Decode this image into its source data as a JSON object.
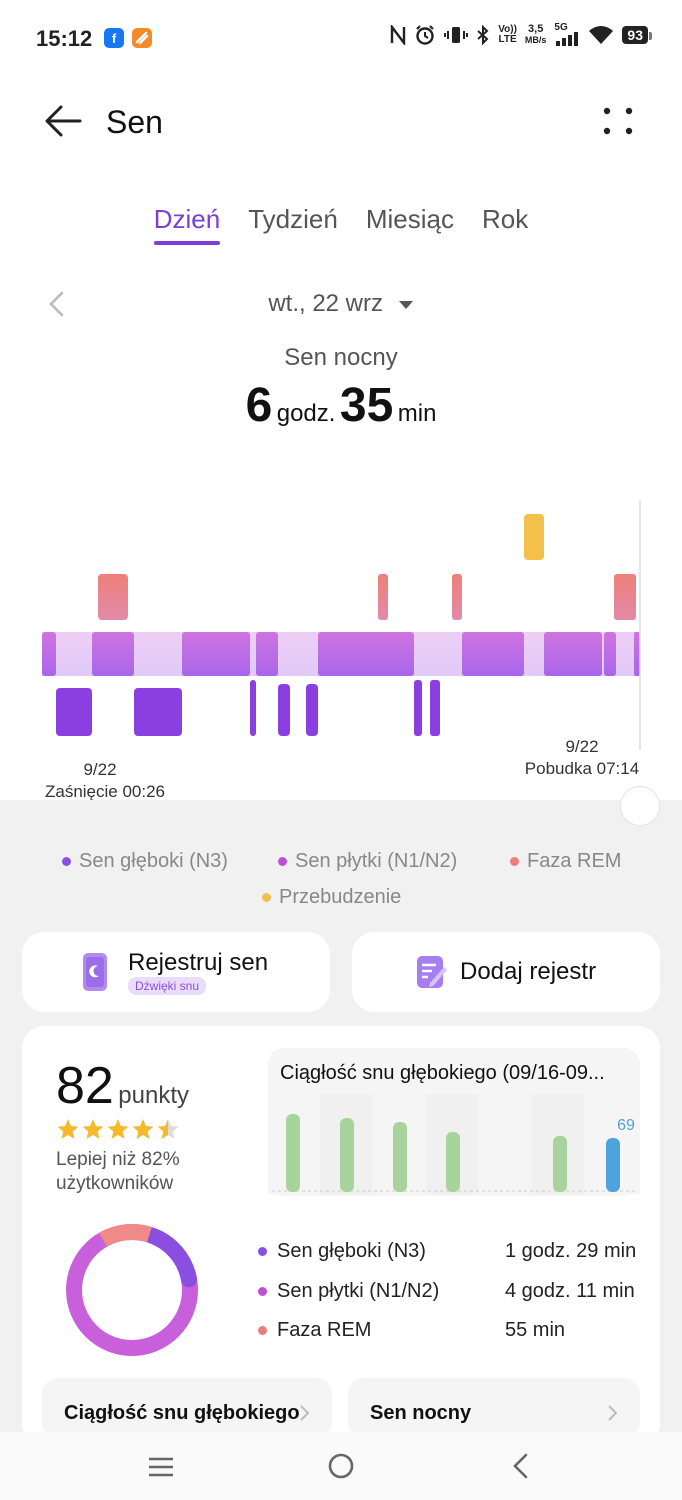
{
  "status_bar": {
    "time": "15:12",
    "icons": [
      "facebook-icon",
      "orange-app-icon",
      "nfc-icon",
      "alarm-icon",
      "vibrate-icon",
      "bluetooth-icon",
      "volte-icon",
      "data-speed",
      "signal-icon",
      "wifi-icon"
    ],
    "volte_top": "Vo))",
    "volte_bottom": "LTE",
    "speed_value": "3,5",
    "speed_unit": "MB/s",
    "network": "5G",
    "battery": "93"
  },
  "header": {
    "title": "Sen",
    "back_icon": "arrow-left-icon",
    "more_icon": "more-dots-icon"
  },
  "tabs": [
    {
      "label": "Dzień",
      "active": true
    },
    {
      "label": "Tydzień",
      "active": false
    },
    {
      "label": "Miesiąc",
      "active": false
    },
    {
      "label": "Rok",
      "active": false
    }
  ],
  "date_selector": {
    "label": "wt., 22 wrz"
  },
  "summary": {
    "label": "Sen nocny",
    "hours": "6",
    "hours_unit": "godz.",
    "minutes": "35",
    "minutes_unit": "min"
  },
  "hypnogram": {
    "start_date": "9/22",
    "start_label": "Zaśnięcie 00:26",
    "end_date": "9/22",
    "end_label": "Pobudka 07:14",
    "stage_colors": {
      "light": "#c261dc",
      "deep": "#8a3fe0",
      "rem": "#ee7f7f",
      "awake": "#f3c14a"
    }
  },
  "legend": [
    {
      "label": "Sen głęboki (N3)",
      "color": "#8a4fe0"
    },
    {
      "label": "Sen płytki (N1/N2)",
      "color": "#c04fd8"
    },
    {
      "label": "Faza REM",
      "color": "#ef7b7b"
    },
    {
      "label": "Przebudzenie",
      "color": "#f3c14a"
    }
  ],
  "actions": {
    "record_label": "Rejestruj sen",
    "record_badge": "Dźwięki snu",
    "add_label": "Dodaj rejestr"
  },
  "score": {
    "value": "82",
    "unit": "punkty",
    "stars": 4.5,
    "compare_line1": "Lepiej niż 82%",
    "compare_line2": "użytkowników"
  },
  "continuity_card": {
    "title": "Ciągłość snu głębokiego (09/16-09...",
    "value_label": "69"
  },
  "breakdown": [
    {
      "label": "Sen głęboki (N3)",
      "value": "1 godz. 29 min",
      "color": "#8a4fe0"
    },
    {
      "label": "Sen płytki (N1/N2)",
      "value": "4 godz. 11 min",
      "color": "#c04fd8"
    },
    {
      "label": "Faza REM",
      "value": "55 min",
      "color": "#ef7b7b"
    }
  ],
  "bottom_cards": [
    {
      "label": "Ciągłość snu głębokiego"
    },
    {
      "label": "Sen nocny"
    }
  ]
}
